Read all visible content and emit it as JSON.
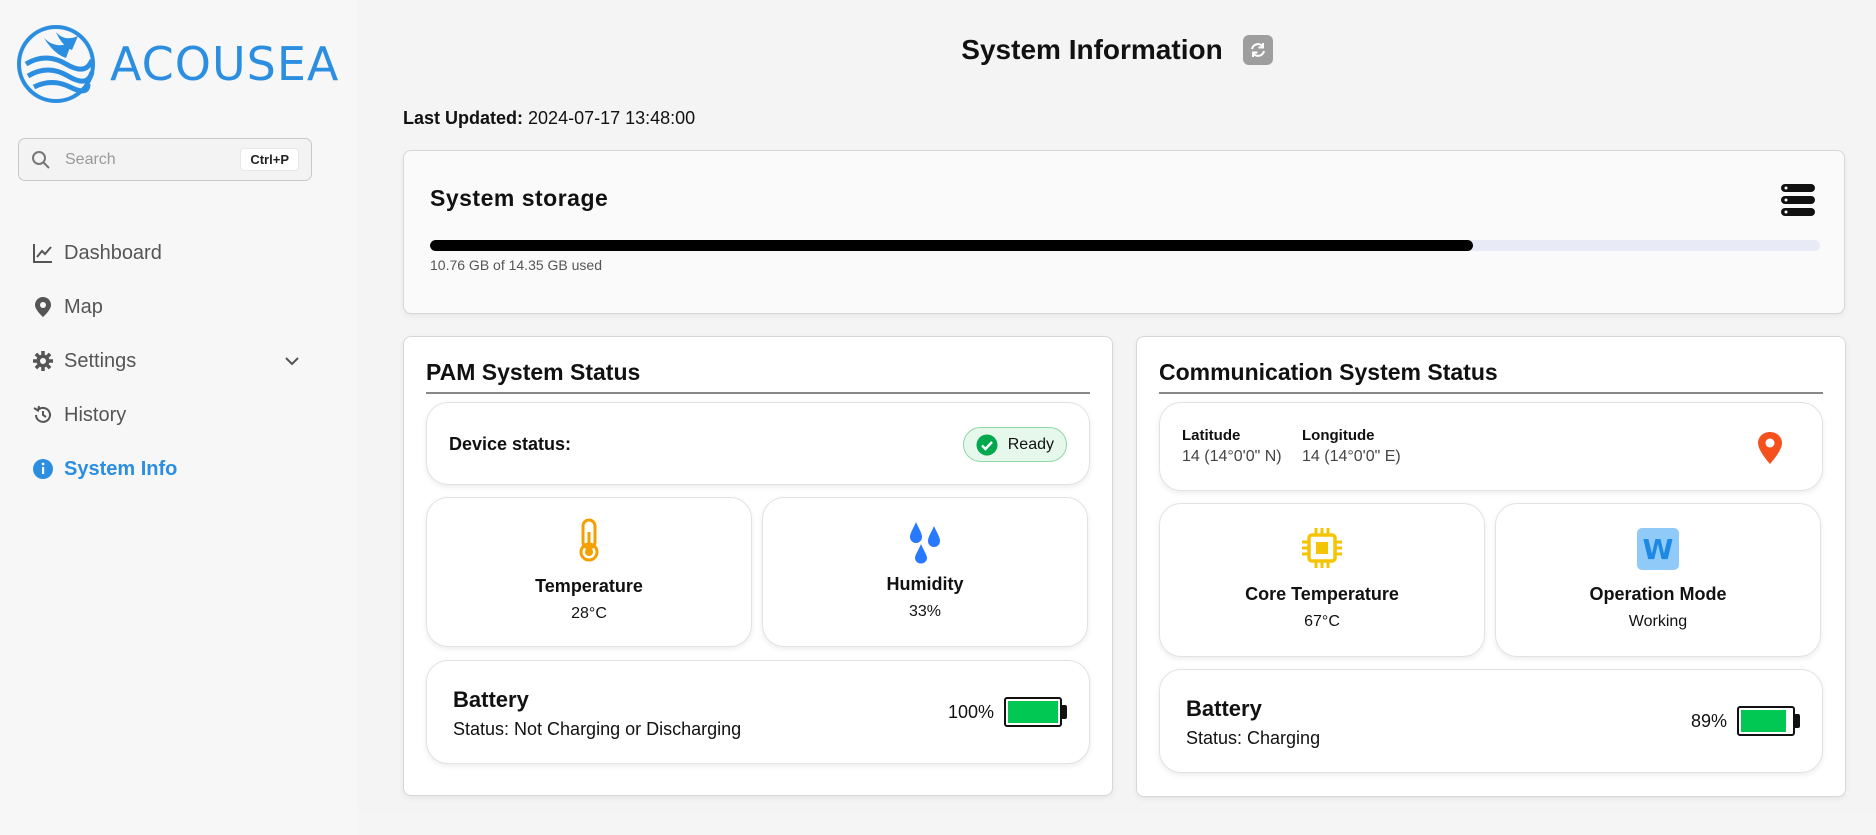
{
  "brand": {
    "name": "ACOUSEA",
    "color": "#2b8ee0"
  },
  "search": {
    "placeholder": "Search",
    "shortcut": "Ctrl+P"
  },
  "sidebar": {
    "items": [
      {
        "label": "Dashboard",
        "icon": "chart-line-icon",
        "active": false
      },
      {
        "label": "Map",
        "icon": "map-pin-icon",
        "active": false
      },
      {
        "label": "Settings",
        "icon": "gear-icon",
        "active": false,
        "expandable": true
      },
      {
        "label": "History",
        "icon": "history-icon",
        "active": false
      },
      {
        "label": "System Info",
        "icon": "info-icon",
        "active": true
      }
    ]
  },
  "header": {
    "title": "System Information",
    "refresh_icon": "refresh-icon"
  },
  "last_updated": {
    "label": "Last Updated:",
    "value": "2024-07-17 13:48:00"
  },
  "storage": {
    "title": "System storage",
    "used_text": "10.76 GB of 14.35 GB used",
    "used_fraction": 0.75,
    "icon": "server-icon"
  },
  "pam": {
    "title": "PAM System Status",
    "device_status_label": "Device status:",
    "device_status_value": "Ready",
    "temperature": {
      "label": "Temperature",
      "value": "28°C",
      "icon": "thermometer-icon"
    },
    "humidity": {
      "label": "Humidity",
      "value": "33%",
      "icon": "water-drops-icon"
    },
    "battery": {
      "title": "Battery",
      "status": "Status: Not Charging or Discharging",
      "percent_text": "100%",
      "level": 1.0
    }
  },
  "comm": {
    "title": "Communication System Status",
    "latitude": {
      "label": "Latitude",
      "value": "14 (14°0'0\" N)"
    },
    "longitude": {
      "label": "Longitude",
      "value": "14 (14°0'0\" E)"
    },
    "core_temperature": {
      "label": "Core Temperature",
      "value": "67°C",
      "icon": "cpu-icon"
    },
    "operation_mode": {
      "label": "Operation Mode",
      "value": "Working",
      "badge": "W"
    },
    "battery": {
      "title": "Battery",
      "status": "Status: Charging",
      "percent_text": "89%",
      "level": 0.89
    }
  },
  "colors": {
    "ready_green": "#00c853",
    "pin_red": "#f4511e",
    "chip_yellow": "#f5c400",
    "thermo_orange": "#f5a000",
    "drops_blue": "#2979ff"
  }
}
